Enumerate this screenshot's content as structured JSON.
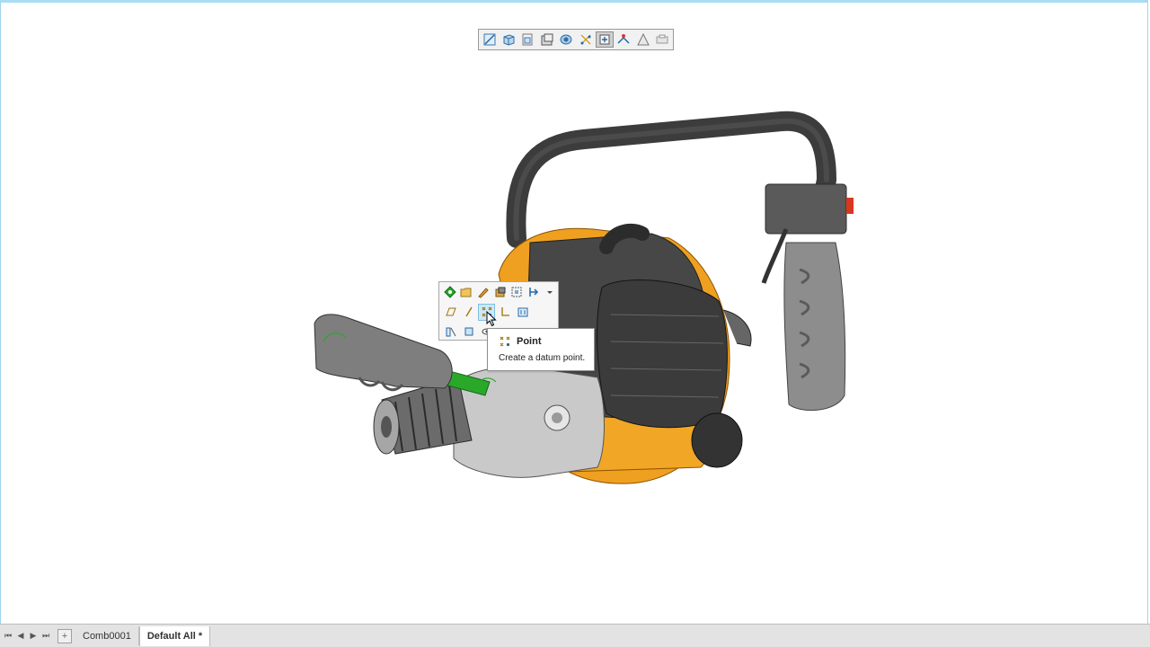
{
  "view_toolbar": {
    "buttons": [
      {
        "icon": "sketch-icon"
      },
      {
        "icon": "cube-view-icon"
      },
      {
        "icon": "saved-orientations-icon"
      },
      {
        "icon": "display-style-icon"
      },
      {
        "icon": "view-manager-icon"
      },
      {
        "icon": "datum-display-icon"
      },
      {
        "icon": "spin-center-icon"
      },
      {
        "icon": "annotation-display-icon"
      },
      {
        "icon": "perspective-icon"
      },
      {
        "icon": "render-icon"
      }
    ]
  },
  "mini_toolbar": {
    "row1": [
      "select-icon",
      "open-icon",
      "appearance-icon",
      "hide-icon",
      "bounding-box-icon",
      "flip-icon"
    ],
    "row2": [
      "plane-icon",
      "axis-icon",
      "point-icon",
      "csys-icon",
      "repeat-icon"
    ],
    "row3": [
      "section-icon",
      "datum-icon",
      "eye-icon"
    ]
  },
  "tooltip": {
    "title": "Point",
    "description": "Create a datum point."
  },
  "tab_bar": {
    "add_label": "+",
    "tabs": [
      {
        "label": "Comb0001",
        "active": false
      },
      {
        "label": "Default All *",
        "active": true
      }
    ]
  },
  "colors": {
    "frame_accent": "#a9dcf3",
    "engine_orange": "#f0a020",
    "handle_dark": "#4a4a4a",
    "highlight_green": "#2aa82a"
  }
}
